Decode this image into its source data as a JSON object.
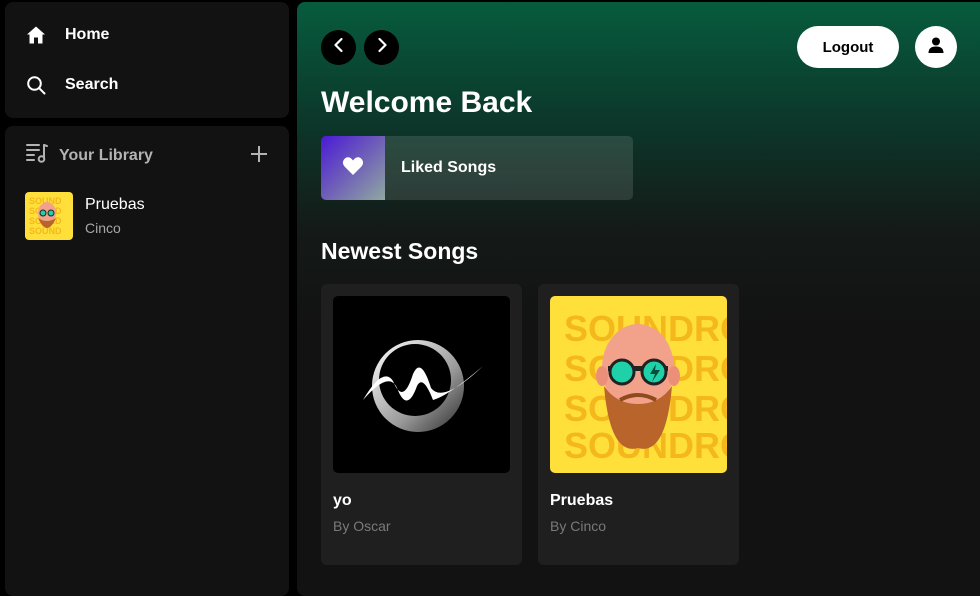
{
  "sidebar": {
    "nav": {
      "home_label": "Home",
      "search_label": "Search"
    },
    "library": {
      "title": "Your Library",
      "items": [
        {
          "title": "Pruebas",
          "subtitle": "Cinco"
        }
      ]
    }
  },
  "header": {
    "logout_label": "Logout"
  },
  "main": {
    "title": "Welcome Back",
    "liked_songs_label": "Liked Songs",
    "section_title": "Newest Songs",
    "songs": [
      {
        "title": "yo",
        "artist": "By Oscar"
      },
      {
        "title": "Pruebas",
        "artist": "By Cinco"
      }
    ],
    "cover_art_text": "SOUNDROLL"
  },
  "colors": {
    "accent_green": "#075c3e",
    "panel": "#121212",
    "card": "#1f1f1f",
    "soundroll_yellow": "#ffe03a"
  },
  "icons": [
    "home-icon",
    "search-icon",
    "library-icon",
    "plus-icon",
    "chevron-left-icon",
    "chevron-right-icon",
    "user-icon",
    "heart-icon"
  ]
}
